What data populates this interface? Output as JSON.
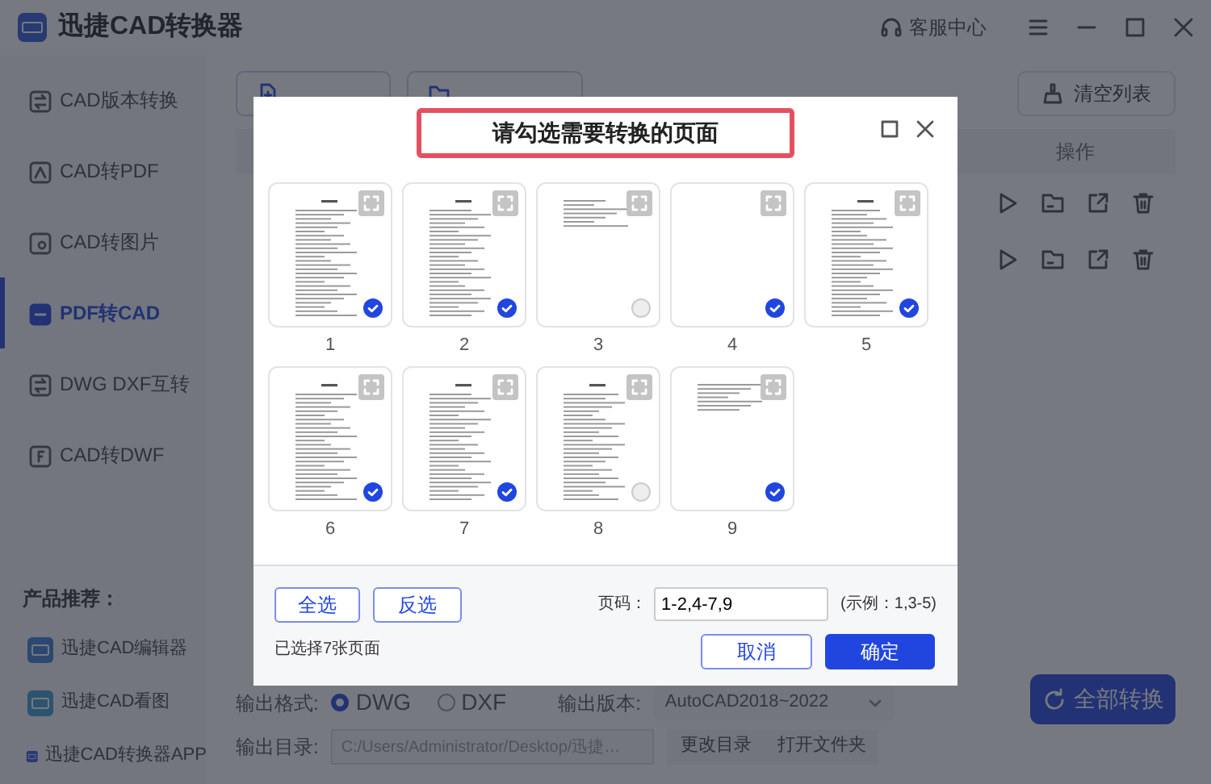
{
  "app": {
    "title": "迅捷CAD转换器",
    "support": "客服中心"
  },
  "sidebar": {
    "items": [
      {
        "label": "CAD版本转换",
        "kind": "version",
        "selected": false
      },
      {
        "label": "CAD转PDF",
        "kind": "pdf",
        "selected": false
      },
      {
        "label": "CAD转图片",
        "kind": "image",
        "selected": false
      },
      {
        "label": "PDF转CAD",
        "kind": "cad",
        "selected": true
      },
      {
        "label": "DWG DXF互转",
        "kind": "swap",
        "selected": false
      },
      {
        "label": "CAD转DWF",
        "kind": "dwf",
        "selected": false
      }
    ],
    "promo_title": "产品推荐：",
    "promos": [
      {
        "label": "迅捷CAD编辑器",
        "kind": "editor"
      },
      {
        "label": "迅捷CAD看图",
        "kind": "viewer"
      },
      {
        "label": "迅捷CAD转换器APP",
        "kind": "app"
      }
    ]
  },
  "toolbar": {
    "buttons": [
      {
        "kind": "file"
      },
      {
        "kind": "folder"
      }
    ],
    "clear": "清空列表"
  },
  "table": {
    "columns": [
      "操作"
    ],
    "rows": [
      {
        "kind": "file"
      },
      {
        "kind": "file"
      }
    ]
  },
  "output": {
    "format_label": "输出格式:",
    "formats": [
      {
        "label": "DWG",
        "selected": true
      },
      {
        "label": "DXF",
        "selected": false
      }
    ],
    "version_label": "输出版本:",
    "version": "AutoCAD2018~2022",
    "dir_label": "输出目录:",
    "dir": "C:/Users/Administrator/Desktop/迅捷…",
    "change_dir": "更改目录",
    "open_folder": "打开文件夹",
    "convert_all": "全部转换"
  },
  "dialog": {
    "title": "请勾选需要转换的页面",
    "pages": [
      {
        "number": "1",
        "kind": "text",
        "selected": true
      },
      {
        "number": "2",
        "kind": "text",
        "selected": true
      },
      {
        "number": "3",
        "kind": "sparse",
        "selected": false
      },
      {
        "number": "4",
        "kind": "blank",
        "selected": true
      },
      {
        "number": "5",
        "kind": "text",
        "selected": true
      },
      {
        "number": "6",
        "kind": "text",
        "selected": true
      },
      {
        "number": "7",
        "kind": "text",
        "selected": true
      },
      {
        "number": "8",
        "kind": "text",
        "selected": false
      },
      {
        "number": "9",
        "kind": "sparse",
        "selected": true
      }
    ],
    "select_all": "全选",
    "invert": "反选",
    "status": "已选择7张页面",
    "page_label": "页码：",
    "page_value": "1-2,4-7,9",
    "example": "(示例：1,3-5)",
    "cancel": "取消",
    "ok": "确定"
  }
}
